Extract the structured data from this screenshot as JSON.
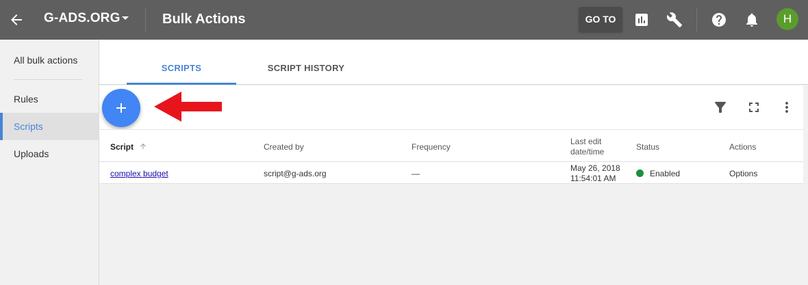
{
  "header": {
    "account_name": "G-ADS.ORG",
    "page_title": "Bulk Actions",
    "goto_label": "GO TO",
    "avatar_initial": "H"
  },
  "sidebar": {
    "items": [
      {
        "label": "All bulk actions"
      },
      {
        "label": "Rules"
      },
      {
        "label": "Scripts",
        "active": true
      },
      {
        "label": "Uploads"
      }
    ]
  },
  "tabs": [
    {
      "label": "SCRIPTS",
      "active": true
    },
    {
      "label": "SCRIPT HISTORY",
      "active": false
    }
  ],
  "table": {
    "columns": [
      "Script",
      "Created by",
      "Frequency",
      "Last edit date/time",
      "Status",
      "Actions"
    ],
    "last_edit_header_line1": "Last edit",
    "last_edit_header_line2": "date/time",
    "rows": [
      {
        "script": "complex budget",
        "created_by": "script@g-ads.org",
        "frequency": "—",
        "last_edit_date": "May 26, 2018",
        "last_edit_time": "11:54:01 AM",
        "status": "Enabled",
        "actions": "Options"
      }
    ]
  },
  "colors": {
    "topbar": "#5f5f5f",
    "accent": "#4a84d6",
    "fab": "#4285f4",
    "status_enabled": "#1e8e3e",
    "arrow": "#e8141c",
    "avatar": "#5b9d2c"
  },
  "icons": [
    "back-arrow-icon",
    "caret-down-icon",
    "bar-chart-icon",
    "wrench-icon",
    "help-icon",
    "bell-icon",
    "plus-icon",
    "filter-icon",
    "fullscreen-icon",
    "more-vert-icon",
    "sort-up-icon"
  ]
}
